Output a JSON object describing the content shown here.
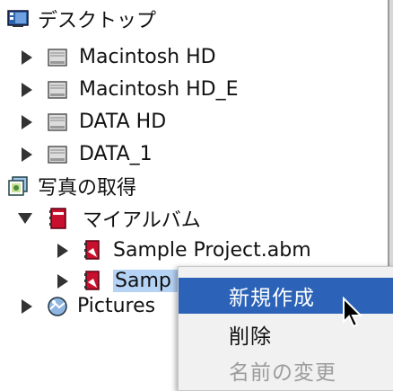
{
  "tree": {
    "items": [
      {
        "label": "デスクトップ",
        "icon": "desktop-icon"
      },
      {
        "label": "Macintosh HD",
        "icon": "hard-drive-icon"
      },
      {
        "label": "Macintosh HD_E",
        "icon": "hard-drive-icon"
      },
      {
        "label": "DATA HD",
        "icon": "hard-drive-icon"
      },
      {
        "label": "DATA_1",
        "icon": "hard-drive-icon"
      },
      {
        "label": "写真の取得",
        "icon": "camera-import-icon"
      },
      {
        "label": "マイアルバム",
        "icon": "album-icon"
      },
      {
        "label": "Sample Project.abm",
        "icon": "album-file-icon"
      },
      {
        "label": "Samp",
        "icon": "album-file-icon"
      },
      {
        "label": "Pictures",
        "icon": "pictures-folder-icon"
      }
    ]
  },
  "context_menu": {
    "items": [
      {
        "label": "新規作成",
        "state": "highlighted"
      },
      {
        "label": "削除",
        "state": "enabled"
      },
      {
        "label": "名前の変更",
        "state": "disabled"
      }
    ]
  },
  "colors": {
    "highlight": "#2c63b8",
    "selection": "#b5d3f5",
    "album_red": "#c8102e"
  }
}
